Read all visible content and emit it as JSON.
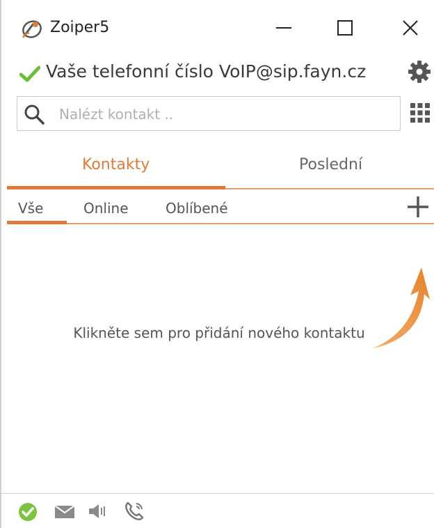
{
  "window": {
    "title": "Zoiper5",
    "accent_color": "#e07b35",
    "status_color": "#6bbf3a"
  },
  "status": {
    "text": "Vaše telefonní číslo VoIP@sip.fayn.cz"
  },
  "search": {
    "placeholder": "Nalézt kontakt .."
  },
  "main_tabs": [
    {
      "label": "Kontakty",
      "active": true
    },
    {
      "label": "Poslední",
      "active": false
    }
  ],
  "sub_tabs": [
    {
      "label": "Vše",
      "active": true
    },
    {
      "label": "Online",
      "active": false
    },
    {
      "label": "Oblíbené",
      "active": false
    }
  ],
  "empty": {
    "hint": "Klikněte sem pro přidání nového kontaktu"
  },
  "icons": {
    "app": "zoiper-logo-icon",
    "minimize": "minimize-icon",
    "maximize": "maximize-icon",
    "close": "close-icon",
    "status": "checkmark-icon",
    "settings": "gear-icon",
    "search": "search-icon",
    "dialpad": "dialpad-icon",
    "add": "plus-icon",
    "bottom": [
      "status-ok-icon",
      "envelope-icon",
      "speaker-icon",
      "phone-icon"
    ]
  }
}
